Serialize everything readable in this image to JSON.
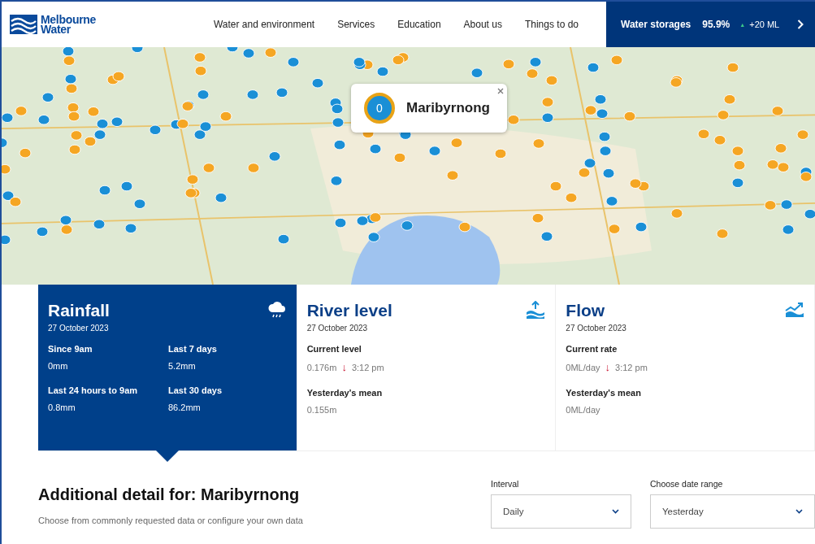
{
  "header": {
    "logo": [
      "Melbourne",
      "Water"
    ],
    "nav": [
      {
        "label": "Water and environment"
      },
      {
        "label": "Services"
      },
      {
        "label": "Education"
      },
      {
        "label": "About us"
      },
      {
        "label": "Things to do"
      }
    ],
    "storages": {
      "label": "Water storages",
      "value": "95.9%",
      "arrow": "▲",
      "change": "+20 ML"
    }
  },
  "map": {
    "popup": {
      "count": "0",
      "name": "Maribyrnong"
    }
  },
  "cards": [
    {
      "kind": "rainfall",
      "title": "Rainfall",
      "date": "27 October 2023",
      "selected": true,
      "stats": [
        {
          "label": "Since 9am",
          "value": "0mm"
        },
        {
          "label": "Last 7 days",
          "value": "5.2mm"
        },
        {
          "label": "Last 24 hours to 9am",
          "value": "0.8mm"
        },
        {
          "label": "Last 30 days",
          "value": "86.2mm"
        }
      ]
    },
    {
      "kind": "river",
      "title": "River level",
      "date": "27 October 2023",
      "selected": false,
      "stats": [
        {
          "label": "Current level",
          "value": "0.176m",
          "arrow": "↓",
          "time": "3:12 pm"
        },
        {
          "label": "Yesterday's mean",
          "value": "0.155m"
        }
      ]
    },
    {
      "kind": "flow",
      "title": "Flow",
      "date": "27 October 2023",
      "selected": false,
      "stats": [
        {
          "label": "Current rate",
          "value": "0ML/day",
          "arrow": "↓",
          "time": "3:12 pm"
        },
        {
          "label": "Yesterday's mean",
          "value": "0ML/day"
        }
      ]
    }
  ],
  "detail": {
    "heading": "Additional detail for: Maribyrnong",
    "subtext": "Choose from commonly requested data or configure your own data",
    "selects": [
      {
        "label": "Interval",
        "value": "Daily"
      },
      {
        "label": "Choose date range",
        "value": "Yesterday"
      }
    ]
  }
}
